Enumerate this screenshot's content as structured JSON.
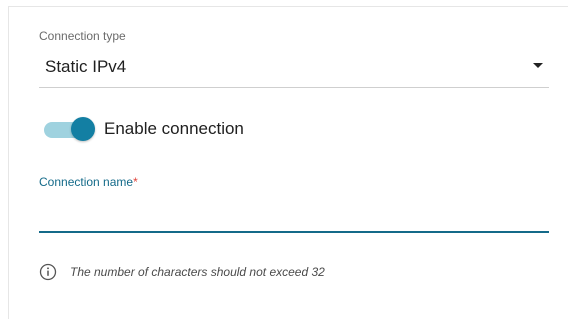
{
  "connection_type": {
    "label": "Connection type",
    "value": "Static IPv4",
    "icon": "caret-down-icon"
  },
  "enable_connection": {
    "label": "Enable connection",
    "checked": true,
    "accent": "#137fa3",
    "track_color": "#9fd2df"
  },
  "connection_name": {
    "label": "Connection name",
    "required_mark": "*",
    "value": "",
    "placeholder": ""
  },
  "hint": {
    "icon": "info-icon",
    "text": "The number of characters should not exceed 32"
  },
  "colors": {
    "focus": "#146a89",
    "required": "#e0443c"
  }
}
